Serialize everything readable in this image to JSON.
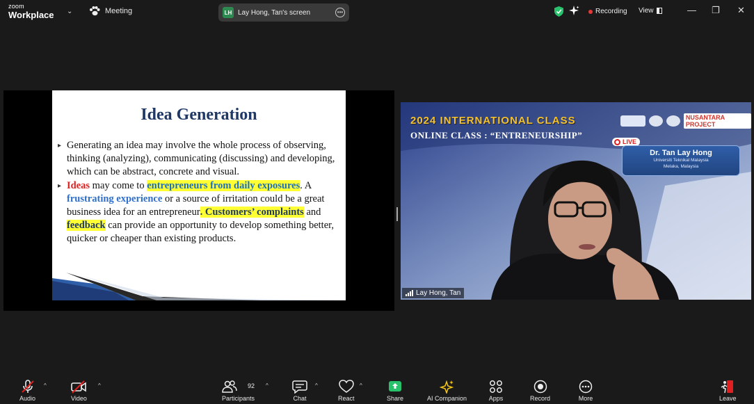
{
  "titlebar": {
    "brand_small": "zoom",
    "brand_big": "Workplace",
    "meeting_label": "Meeting",
    "screen_badge": "LH",
    "screen_label": "Lay Hong, Tan's screen",
    "recording_label": "Recording",
    "view_label": "View",
    "min_glyph": "—",
    "max_glyph": "❐",
    "close_glyph": "✕"
  },
  "slide": {
    "title": "Idea Generation",
    "bullet1": "Generating an idea may involve the whole process of observing, thinking (analyzing), communicating (discussing) and developing, which can be abstract, concrete and visual.",
    "b2_ideas": "Ideas",
    "b2_t1": " may come to ",
    "b2_hl1": "entrepreneurs from daily exposures",
    "b2_t2": ". A ",
    "b2_blue": "frustrating experience",
    "b2_t3": " or a source of irritation could be a great business idea for an entrepreneur",
    "b2_hl2": ". Customers’ complaints",
    "b2_t4": " and ",
    "b2_hl3": "feedback",
    "b2_t5": " can provide an opportunity to develop something better, quicker or cheaper than existing products."
  },
  "video": {
    "banner_title": "2024 INTERNATIONAL CLASS",
    "banner_sub": "ONLINE CLASS : “ENTRENEURSHIP”",
    "nusantara": "NUSANTARA PROJECT",
    "live": "LIVE",
    "card_name": "Dr. Tan Lay Hong",
    "card_line1": "Universiti Teknikal Malaysia",
    "card_line2": "Melaka, Malaysia",
    "participant_name": "Lay Hong, Tan"
  },
  "toolbar": {
    "audio": "Audio",
    "video": "Video",
    "participants": "Participants",
    "participants_count": "92",
    "chat": "Chat",
    "react": "React",
    "share": "Share",
    "ai_companion": "AI Companion",
    "apps": "Apps",
    "record": "Record",
    "more": "More",
    "leave": "Leave",
    "caret": "^"
  },
  "colors": {
    "background": "#1a1a1a",
    "share_green": "#27c26b",
    "leave_red": "#e02020",
    "recording_red": "#e53935",
    "highlight_yellow": "#ffff33",
    "slide_title_navy": "#1f3864"
  }
}
